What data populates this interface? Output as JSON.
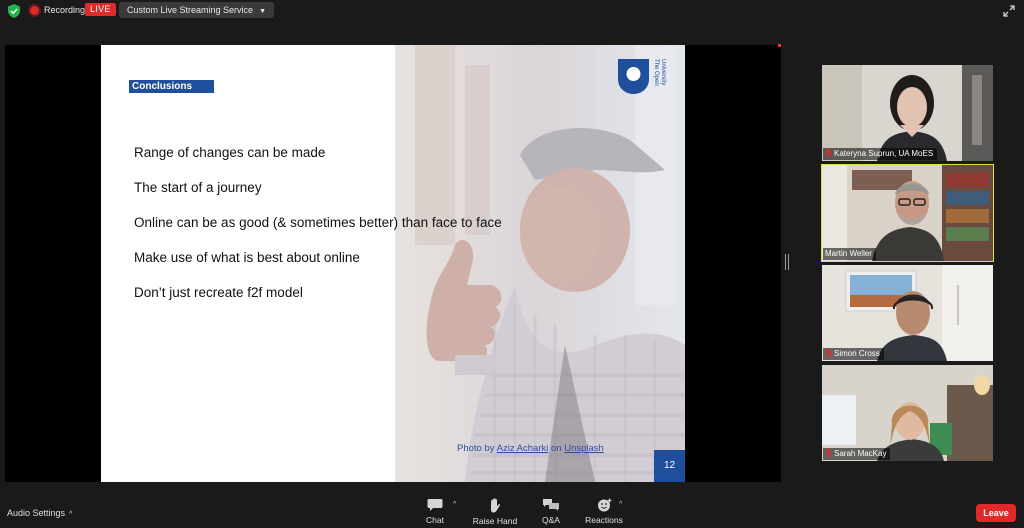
{
  "topbar": {
    "recording_label": "Recording",
    "live_label": "LIVE",
    "streaming_service_label": "Custom Live Streaming Service",
    "icons": [
      "shield-check-icon",
      "record-icon",
      "chevron-down-icon",
      "expand-icon"
    ]
  },
  "slide": {
    "heading": "Conclusions",
    "bullets": [
      "Range of changes can be made",
      "The start of a journey",
      "Online can be as good (& sometimes better) than face to face",
      "Make use of what is best about online",
      "Don’t just recreate f2f model"
    ],
    "logo_text_line1": "The Open",
    "logo_text_line2": "University",
    "credit_prefix": "Photo by ",
    "credit_author": "Aziz Acharki",
    "credit_middle": " on ",
    "credit_source": "Unsplash",
    "page_number": "12",
    "accent_color": "#1f4f9c"
  },
  "participants": [
    {
      "name": "Kateryna Suprun, UA MoES",
      "muted": true,
      "active": false
    },
    {
      "name": "Martin Weller",
      "muted": false,
      "active": true
    },
    {
      "name": "Simon Cross",
      "muted": true,
      "active": false
    },
    {
      "name": "Sarah MacKay",
      "muted": true,
      "active": false
    }
  ],
  "toolbar": {
    "audio_settings_label": "Audio Settings",
    "chat_label": "Chat",
    "raise_hand_label": "Raise Hand",
    "qa_label": "Q&A",
    "reactions_label": "Reactions",
    "leave_label": "Leave",
    "leave_color": "#e02a2a"
  }
}
